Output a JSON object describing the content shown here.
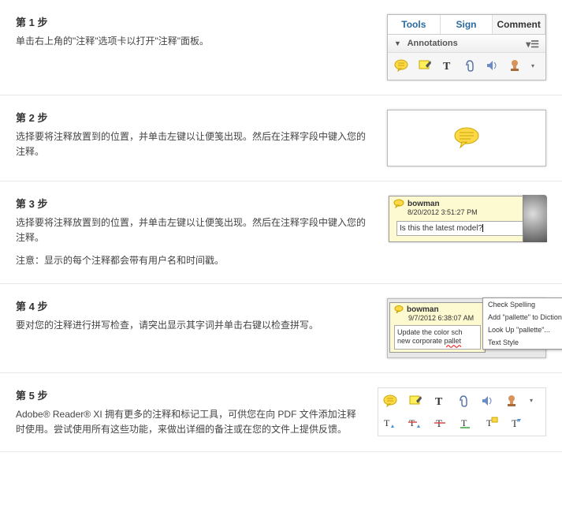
{
  "steps": [
    {
      "title": "第 1 步",
      "desc": "单击右上角的\"注释\"选项卡以打开\"注释\"面板。"
    },
    {
      "title": "第 2 步",
      "desc": "选择要将注释放置到的位置，并单击左键以让便笺出现。然后在注释字段中键入您的注释。"
    },
    {
      "title": "第 3 步",
      "desc": "选择要将注释放置到的位置，并单击左键以让便笺出现。然后在注释字段中键入您的注释。",
      "note": "注意：显示的每个注释都会带有用户名和时间戳。"
    },
    {
      "title": "第 4 步",
      "desc": "要对您的注释进行拼写检查，请突出显示其字词并单击右键以检查拼写。"
    },
    {
      "title": "第 5 步",
      "desc": "Adobe® Reader® XI 拥有更多的注释和标记工具，可供您在向 PDF 文件添加注释时使用。尝试使用所有这些功能，来做出详细的备注或在您的文件上提供反馈。"
    }
  ],
  "panel1": {
    "tabs": [
      {
        "label": "Tools"
      },
      {
        "label": "Sign"
      },
      {
        "label": "Comment"
      }
    ],
    "section": "Annotations"
  },
  "panel3": {
    "user": "bowman",
    "date": "8/20/2012 3:51:27 PM",
    "text": "Is this the latest model?"
  },
  "panel4": {
    "user": "bowman",
    "date": "9/7/2012 6:38:07 AM",
    "text_prefix": "Update the color sch",
    "text_line2": "new corporate ",
    "text_bad": "pallet",
    "menu": [
      "Check Spelling",
      "Add \"pallette\" to Dictionary",
      "Look Up \"pallette\"...",
      "Text Style"
    ]
  }
}
